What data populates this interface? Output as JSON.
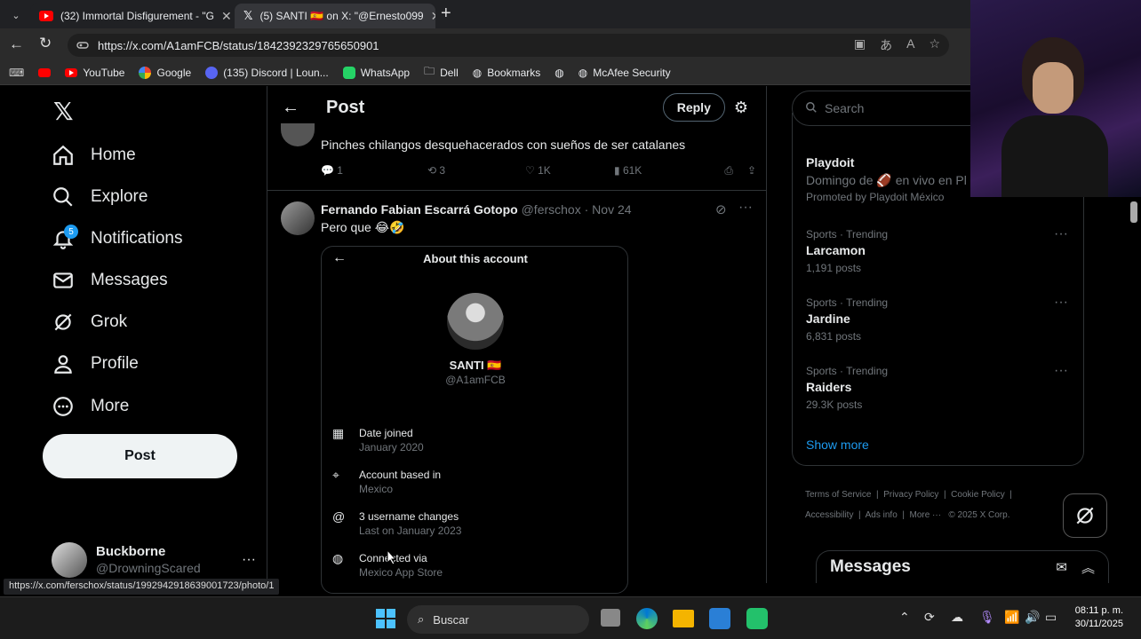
{
  "browser": {
    "tabs": [
      {
        "title": "(32) Immortal Disfigurement - \"G"
      },
      {
        "title": "(5) SANTI 🇪🇸 on X: \"@Ernesto099"
      }
    ],
    "new_tab": "+",
    "url": "https://x.com/A1amFCB/status/1842392329765650901",
    "bookmarks": [
      "YouTube",
      "Google",
      "(135) Discord | Loun...",
      "WhatsApp",
      "Dell",
      "Bookmarks",
      "McAfee Security"
    ]
  },
  "nav": {
    "items": [
      {
        "label": "Home",
        "icon": "home-icon"
      },
      {
        "label": "Explore",
        "icon": "search-icon"
      },
      {
        "label": "Notifications",
        "icon": "bell-icon",
        "badge": "5"
      },
      {
        "label": "Messages",
        "icon": "mail-icon"
      },
      {
        "label": "Grok",
        "icon": "grok-icon"
      },
      {
        "label": "Profile",
        "icon": "person-icon"
      },
      {
        "label": "More",
        "icon": "more-circle-icon"
      }
    ],
    "post_button": "Post",
    "account": {
      "name": "Buckborne",
      "handle": "@DrowningScared"
    }
  },
  "header": {
    "title": "Post",
    "reply_button": "Reply"
  },
  "reply1": {
    "text": "Pinches chilangos desquehacerados con sueños de ser catalanes",
    "stats": {
      "replies": "1",
      "reposts": "3",
      "likes": "1K",
      "views": "61K"
    }
  },
  "reply2": {
    "name": "Fernando Fabian Escarrá Gotopo",
    "handle": "@ferschox",
    "date": "Nov 24",
    "text": "Pero que 😂🤣",
    "about": {
      "title": "About this account",
      "name": "SANTI 🇪🇸",
      "handle": "@A1amFCB",
      "rows": [
        {
          "label": "Date joined",
          "value": "January 2020",
          "icon": "calendar-icon"
        },
        {
          "label": "Account based in",
          "value": "Mexico",
          "icon": "location-icon"
        },
        {
          "label": "3 username changes",
          "value": "Last on January 2023",
          "icon": "at-icon"
        },
        {
          "label": "Connected via",
          "value": "Mexico App Store",
          "icon": "globe-icon"
        }
      ]
    }
  },
  "sidebar": {
    "search_placeholder": "Search",
    "promo": {
      "name": "Playdoit",
      "text": "Domingo de 🏈 en vivo en Pl",
      "promoted": "Promoted by Playdoit México"
    },
    "trends": [
      {
        "category": "Sports · Trending",
        "name": "Larcamon",
        "count": "1,191 posts"
      },
      {
        "category": "Sports · Trending",
        "name": "Jardine",
        "count": "6,831 posts"
      },
      {
        "category": "Sports · Trending",
        "name": "Raiders",
        "count": "29.3K posts"
      }
    ],
    "show_more": "Show more",
    "footer": [
      "Terms of Service",
      "Privacy Policy",
      "Cookie Policy",
      "Accessibility",
      "Ads info",
      "More ···",
      "© 2025 X Corp."
    ],
    "messages_drawer": "Messages"
  },
  "status_url": "https://x.com/ferschox/status/1992942918639001723/photo/1",
  "taskbar": {
    "search": "Buscar",
    "time": "08:11 p. m.",
    "date": "30/11/2025"
  },
  "colors": {
    "accent": "#1d9bf0",
    "background": "#000000",
    "border": "#2f3336",
    "muted": "#71767b"
  }
}
